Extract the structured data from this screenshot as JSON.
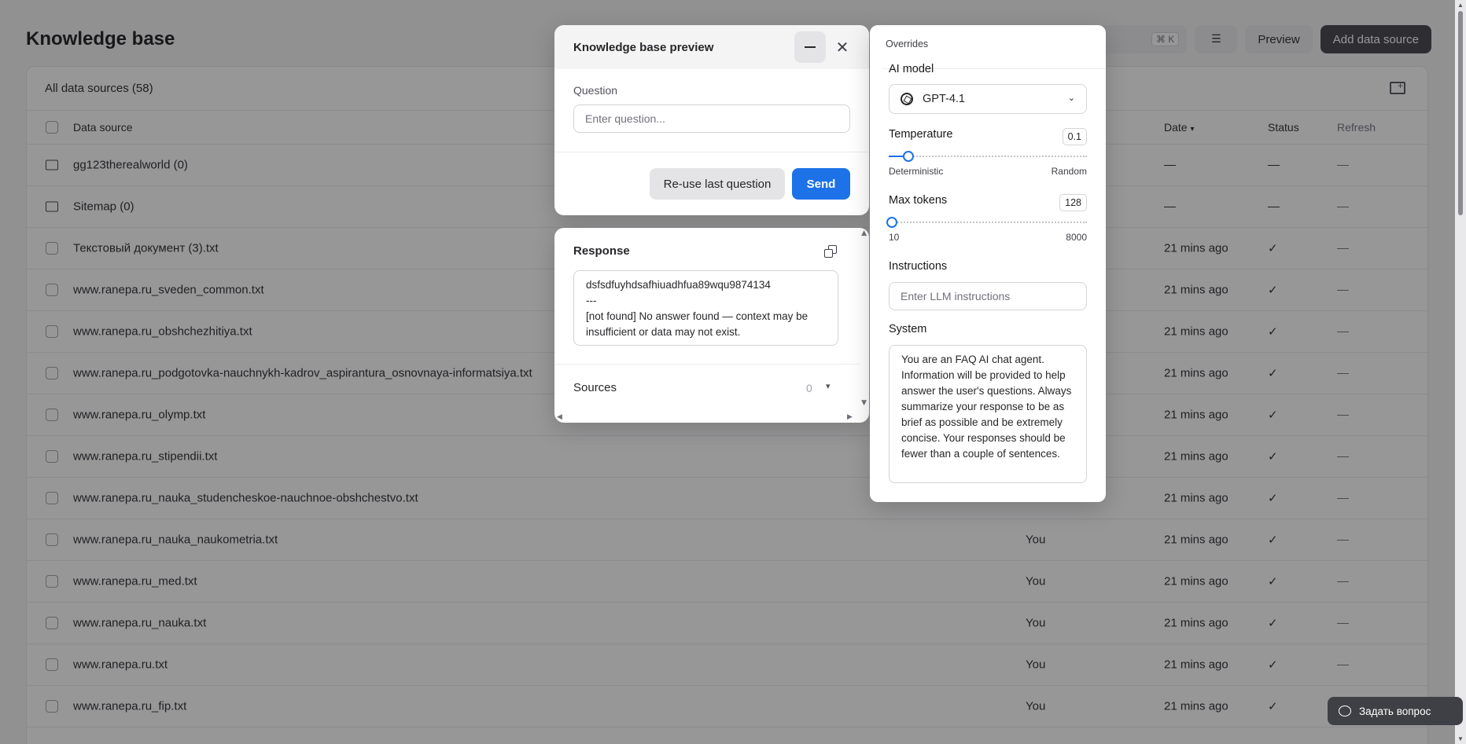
{
  "page": {
    "title": "Knowledge base",
    "shortcut": "⌘ K",
    "preview_label": "Preview",
    "add_source_label": "Add data source"
  },
  "sources_card": {
    "header": "All data sources (58)",
    "columns": {
      "name": "Data source",
      "date": "Date",
      "status": "Status",
      "refresh": "Refresh"
    },
    "rows": [
      {
        "name": "gg123therealworld (0)",
        "folder": true,
        "owner": "",
        "date": "—",
        "status": "—",
        "refresh": "—"
      },
      {
        "name": "Sitemap (0)",
        "folder": true,
        "owner": "",
        "date": "—",
        "status": "—",
        "refresh": "—"
      },
      {
        "name": "Текстовый документ (3).txt",
        "folder": false,
        "owner": "",
        "date": "21 mins ago",
        "status": "✓",
        "refresh": "—"
      },
      {
        "name": "www.ranepa.ru_sveden_common.txt",
        "folder": false,
        "owner": "",
        "date": "21 mins ago",
        "status": "✓",
        "refresh": "—"
      },
      {
        "name": "www.ranepa.ru_obshchezhitiya.txt",
        "folder": false,
        "owner": "",
        "date": "21 mins ago",
        "status": "✓",
        "refresh": "—"
      },
      {
        "name": "www.ranepa.ru_podgotovka-nauchnykh-kadrov_aspirantura_osnovnaya-informatsiya.txt",
        "folder": false,
        "owner": "",
        "date": "21 mins ago",
        "status": "✓",
        "refresh": "—"
      },
      {
        "name": "www.ranepa.ru_olymp.txt",
        "folder": false,
        "owner": "",
        "date": "21 mins ago",
        "status": "✓",
        "refresh": "—"
      },
      {
        "name": "www.ranepa.ru_stipendii.txt",
        "folder": false,
        "owner": "",
        "date": "21 mins ago",
        "status": "✓",
        "refresh": "—"
      },
      {
        "name": "www.ranepa.ru_nauka_studencheskoe-nauchnoe-obshchestvo.txt",
        "folder": false,
        "owner": "",
        "date": "21 mins ago",
        "status": "✓",
        "refresh": "—"
      },
      {
        "name": "www.ranepa.ru_nauka_naukometria.txt",
        "folder": false,
        "owner": "You",
        "date": "21 mins ago",
        "status": "✓",
        "refresh": "—"
      },
      {
        "name": "www.ranepa.ru_med.txt",
        "folder": false,
        "owner": "You",
        "date": "21 mins ago",
        "status": "✓",
        "refresh": "—"
      },
      {
        "name": "www.ranepa.ru_nauka.txt",
        "folder": false,
        "owner": "You",
        "date": "21 mins ago",
        "status": "✓",
        "refresh": "—"
      },
      {
        "name": "www.ranepa.ru.txt",
        "folder": false,
        "owner": "You",
        "date": "21 mins ago",
        "status": "✓",
        "refresh": "—"
      },
      {
        "name": "www.ranepa.ru_fip.txt",
        "folder": false,
        "owner": "You",
        "date": "21 mins ago",
        "status": "✓",
        "refresh": "—"
      }
    ]
  },
  "preview_dialog": {
    "title": "Knowledge base preview",
    "question_label": "Question",
    "question_placeholder": "Enter question...",
    "question_value": "",
    "reuse_label": "Re-use last question",
    "send_label": "Send"
  },
  "response_dialog": {
    "title": "Response",
    "line1": "dsfsdfuyhdsafhiuadhfua89wqu9874134",
    "line2": "---",
    "line3": "[not found] No answer found — context may be insufficient or data may not exist.",
    "sources_label": "Sources",
    "sources_count": "0"
  },
  "overrides": {
    "title": "Overrides",
    "model_label": "AI model",
    "model_value": "GPT-4.1",
    "temperature_label": "Temperature",
    "temperature_value": "0.1",
    "temperature_fraction": 0.1,
    "temp_min_label": "Deterministic",
    "temp_max_label": "Random",
    "max_tokens_label": "Max tokens",
    "max_tokens_value": "128",
    "max_tokens_fraction": 0.015,
    "tokens_min_label": "10",
    "tokens_max_label": "8000",
    "instructions_label": "Instructions",
    "instructions_placeholder": "Enter LLM instructions",
    "system_label": "System",
    "system_text": "You are an FAQ AI chat agent. Information will be provided to help answer the user's questions. Always summarize your response to be as brief as possible and be extremely concise. Your responses should be fewer than a couple of sentences."
  },
  "help_widget": {
    "label": "Задать вопрос"
  },
  "colors": {
    "primary": "#1d72e8",
    "dark_button": "#3f3f46"
  }
}
